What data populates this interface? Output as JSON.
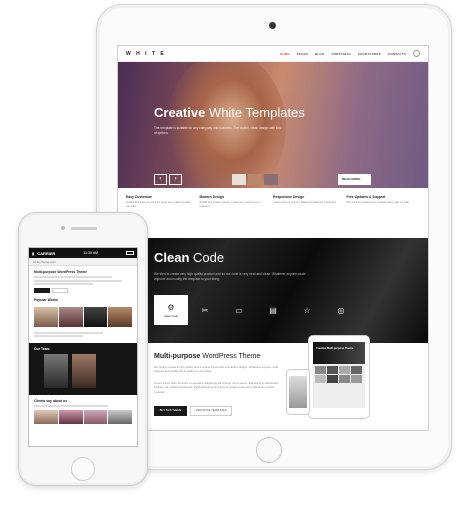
{
  "colors": {
    "accent": "#e74c3c",
    "dark_section": "#111111",
    "hero_start": "#4a2d57",
    "hero_end": "#6f5a84"
  },
  "ipad": {
    "nav": {
      "logo": "W H I T E",
      "links": [
        "HOME",
        "PAGES",
        "BLOG",
        "PORTFOLIO",
        "SHORTCODES",
        "CONTACTS"
      ],
      "active_index": 0,
      "search_icon": "search-icon"
    },
    "hero": {
      "title_bold": "Creative",
      "title_rest": " White Templates",
      "text": "The template is suitable for any company and business. The stylish, clean design with lots of options.",
      "prev_icon": "chevron-left-icon",
      "next_icon": "chevron-right-icon",
      "cta_label": "READ MORE"
    },
    "features": [
      {
        "title": "Easy Customize",
        "text": "Quality and ease are what we strive for in each template we make."
      },
      {
        "title": "Modern Design",
        "text": "Stylish and modern design meets every need of your business."
      },
      {
        "title": "Responsive Design",
        "text": "Looks great on phones, tablets and desktop computers."
      },
      {
        "title": "Free Updates & Support",
        "text": "Buy once and receive free updates along with our help."
      }
    ],
    "clean": {
      "title_bold": "Clean",
      "title_rest": " Code",
      "text": "We tried to create very high quality product and so our code is very neat and clean. Whatever anyone could improve and modify the template to your liking.",
      "icons": [
        {
          "name": "gear-icon",
          "glyph": "⚙",
          "label": "Clean Code",
          "selected": true
        },
        {
          "name": "tools-icon",
          "glyph": "✂",
          "label": "",
          "selected": false
        },
        {
          "name": "monitor-icon",
          "glyph": "▭",
          "label": "",
          "selected": false
        },
        {
          "name": "document-icon",
          "glyph": "▤",
          "label": "",
          "selected": false
        },
        {
          "name": "star-icon",
          "glyph": "☆",
          "label": "",
          "selected": false
        },
        {
          "name": "support-icon",
          "glyph": "◎",
          "label": "",
          "selected": false
        }
      ]
    },
    "multi": {
      "title_bold": "Multi-purpose",
      "title_rest": " WordPress Theme",
      "paragraph1": "We tried to create a high quality and a unique theme with a beautiful design. Whatever anyone could improve and modify the template to your liking.",
      "paragraph2": "Lorem ipsum dolor sit amet, consectetur adipiscing elit. Integer lorem quam, adipiscing condimentum tristique vel, eleifend sed turpis. Pellentesque cursus arcu id magna euismod in elementum purus molestie.",
      "primary_label": "BUY THIS THEME",
      "secondary_label": "VIEW MORE TEMPLATES",
      "mini_banner": "Creative Multi-purpose Theme"
    }
  },
  "iphone": {
    "status": {
      "carrier": "CARRIER",
      "time": "11:30 AM"
    },
    "url": "white-theme.com",
    "intro_title": "Multi-purpose WordPress Theme",
    "popular_label": "Popular Works",
    "team_label": "Our Team",
    "clients_label": "Clients say about us"
  }
}
